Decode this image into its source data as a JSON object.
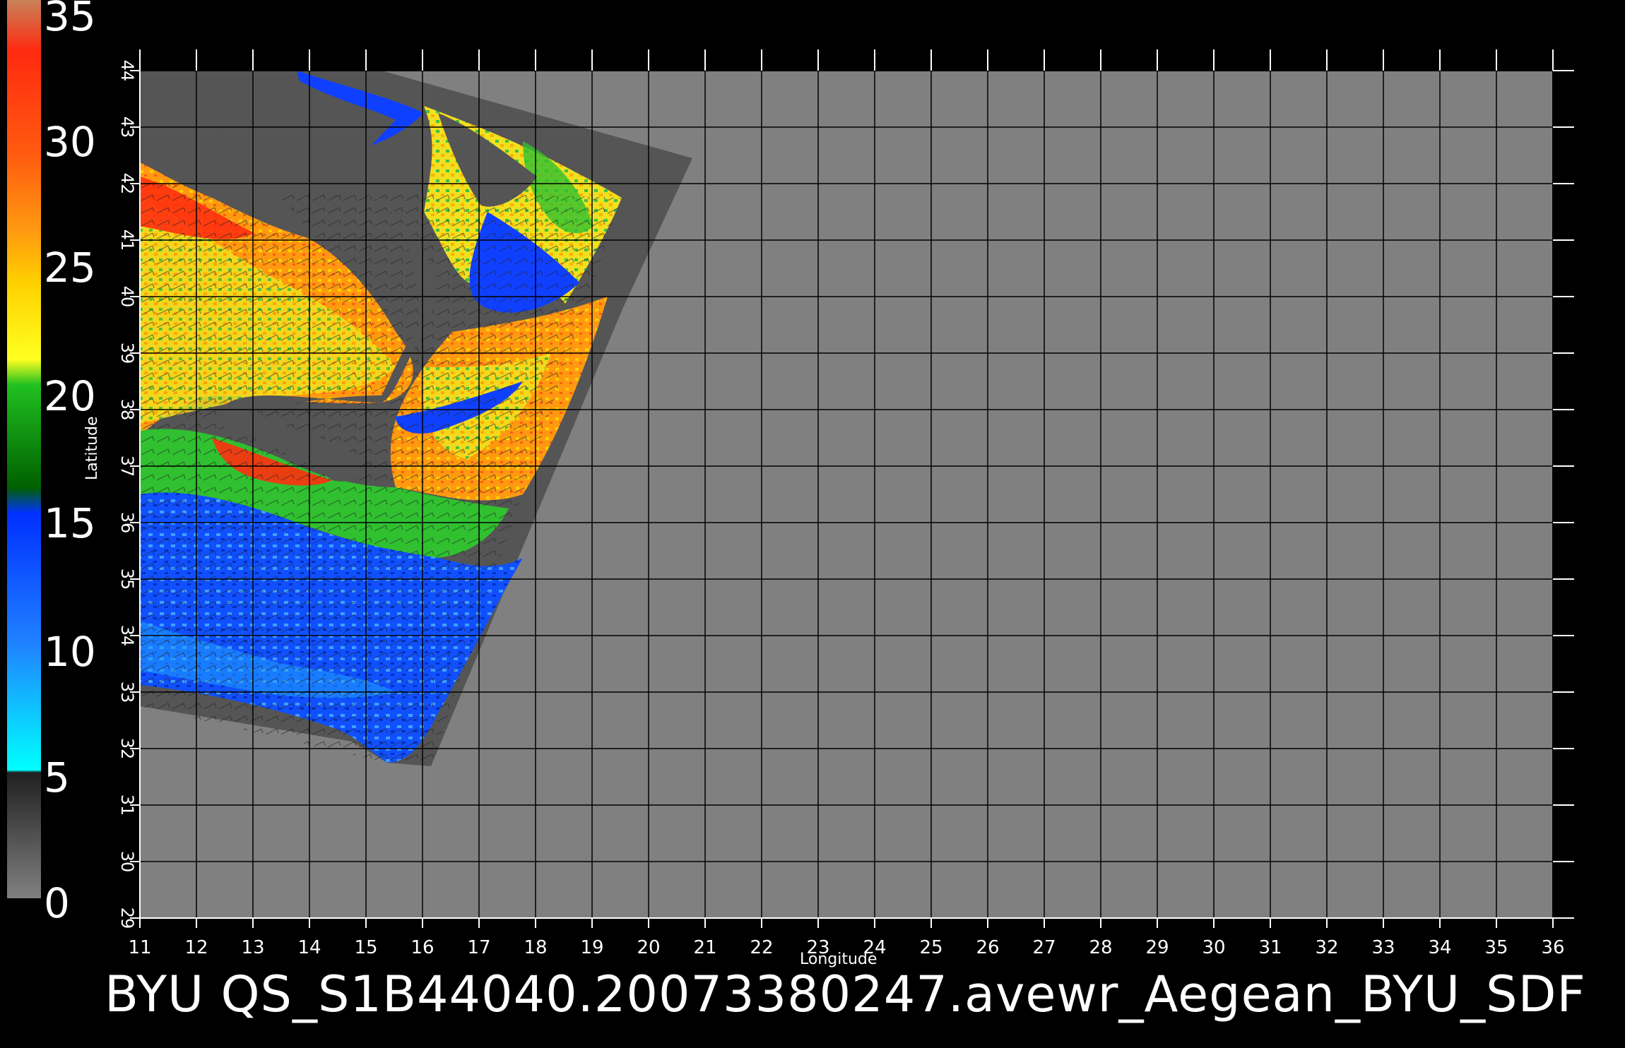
{
  "map": {
    "footer_text": "BYU  QS_S1B44040.20073380247.avewr_Aegean_BYU_SDF",
    "x_axis_label": "Longitude",
    "y_axis_label": "Latitude",
    "longitude_ticks": [
      "11",
      "12",
      "13",
      "14",
      "15",
      "16",
      "17",
      "18",
      "19",
      "20",
      "21",
      "22",
      "23",
      "24",
      "25",
      "26",
      "27",
      "28",
      "29",
      "30",
      "31",
      "32",
      "33",
      "34",
      "35",
      "36"
    ],
    "latitude_ticks": [
      "29",
      "30",
      "31",
      "32",
      "33",
      "34",
      "35",
      "36",
      "37",
      "38",
      "39",
      "40",
      "41",
      "42",
      "43",
      "44"
    ],
    "longitude_range": [
      11,
      36
    ],
    "latitude_range": [
      29,
      44
    ],
    "colorbar": {
      "labels": [
        "35",
        "30",
        "25",
        "20",
        "15",
        "10",
        "5",
        "0"
      ],
      "range": [
        0,
        35
      ],
      "stops": [
        {
          "value": 35,
          "color": "#c8825a"
        },
        {
          "value": 33,
          "color": "#ff2a10"
        },
        {
          "value": 29,
          "color": "#ff5a10"
        },
        {
          "value": 26,
          "color": "#ff9a10"
        },
        {
          "value": 24,
          "color": "#ffd000"
        },
        {
          "value": 21,
          "color": "#ffff20"
        },
        {
          "value": 20,
          "color": "#20c020"
        },
        {
          "value": 16,
          "color": "#006000"
        },
        {
          "value": 15,
          "color": "#0030ff"
        },
        {
          "value": 10,
          "color": "#2080ff"
        },
        {
          "value": 5,
          "color": "#00ffff"
        },
        {
          "value": 4.9,
          "color": "#202020"
        },
        {
          "value": 0,
          "color": "#808080"
        }
      ]
    },
    "colors": {
      "background": "#000000",
      "no_data": "#808080",
      "land": "#555555",
      "grid": "#000000",
      "ocean_low": "#1040ff",
      "ocean_mid": "#30c030",
      "ocean_high": "#ff3010"
    }
  }
}
